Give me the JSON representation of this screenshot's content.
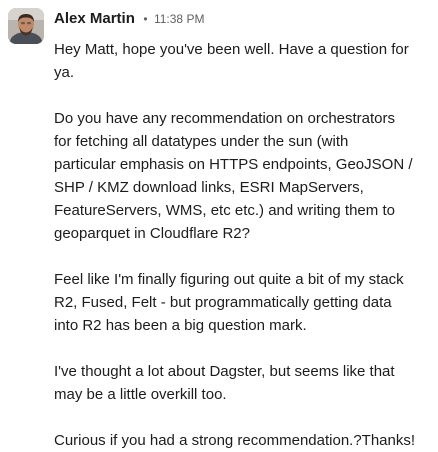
{
  "message": {
    "author": "Alex Martin",
    "separator": "•",
    "timestamp": "11:38 PM",
    "paragraphs": [
      "Hey Matt, hope you've been well. Have a question for\nya.",
      "Do you have any recommendation on orchestrators\nfor fetching all datatypes under the sun (with\nparticular emphasis on HTTPS endpoints, GeoJSON /\nSHP / KMZ download links, ESRI MapServers,\nFeatureServers, WMS, etc etc.) and writing them to\ngeoparquet in Cloudflare R2?",
      "Feel like I'm finally figuring out quite a bit of my stack\nR2, Fused, Felt - but programmatically getting data\ninto R2 has been a big question mark.",
      "I've thought a lot about Dagster, but seems like that\nmay be a little overkill too.",
      "Curious if you had a strong recommendation.?Thanks!"
    ]
  }
}
